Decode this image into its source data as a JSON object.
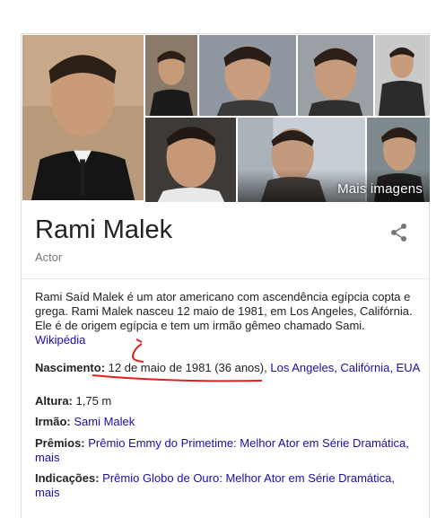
{
  "knowledge_panel": {
    "more_images_label": "Mais imagens",
    "name": "Rami Malek",
    "subtitle": "Actor",
    "description": "Rami Saíd Malek é um ator americano com ascendência egípcia copta e grega. Rami Malek nasceu 12 maio de 1981, em Los Angeles, Califórnia. Ele é de origem egípcia e tem um irmão gêmeo chamado Sami.",
    "source_link": "Wikipédia",
    "facts": {
      "birth": {
        "label": "Nascimento:",
        "value": "12 de maio de 1981 (36 anos),",
        "place_link": "Los Angeles, Califórnia, EUA"
      },
      "height": {
        "label": "Altura:",
        "value": "1,75 m"
      },
      "sibling": {
        "label": "Irmão:",
        "link": "Sami Malek"
      },
      "awards": {
        "label": "Prêmios:",
        "link": "Prêmio Emmy do Primetime: Melhor Ator em Série Dramática,",
        "more": "mais"
      },
      "nominations": {
        "label": "Indicações:",
        "link": "Prêmio Globo de Ouro: Melhor Ator em Série Dramática,",
        "more": "mais"
      }
    },
    "colors": {
      "link": "#1a0dab",
      "annotation": "#e02020"
    }
  }
}
